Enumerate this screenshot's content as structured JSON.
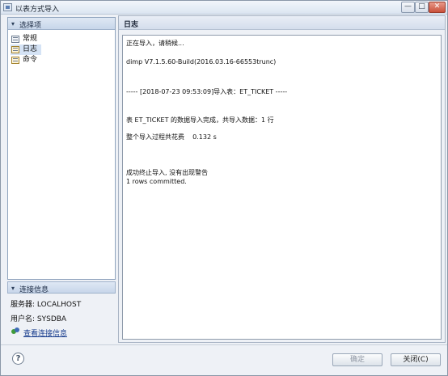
{
  "window": {
    "title": "以表方式导入",
    "min_symbol": "—",
    "max_symbol": "□",
    "close_symbol": "✕"
  },
  "sidebar": {
    "title": "选择项",
    "toggle": "▾",
    "items": [
      {
        "label": "常规",
        "icon": "document-icon"
      },
      {
        "label": "日志",
        "icon": "pencil-icon"
      },
      {
        "label": "命令",
        "icon": "pencil-icon"
      }
    ]
  },
  "connection": {
    "title": "连接信息",
    "toggle": "▾",
    "server_label": "服务器: LOCALHOST",
    "user_label": "用户名: SYSDBA",
    "link_text": "查看连接信息"
  },
  "log_panel": {
    "title": "日志",
    "lines": [
      "正在导入，请稍候...",
      "dimp V7.1.5.60-Build(2016.03.16-66553trunc)",
      "----- [2018-07-23 09:53:09]导入表：ET_TICKET -----",
      "表 ET_TICKET 的数据导入完成，共导入数据：1 行",
      "整个导入过程共花费    0.132 s",
      "成功终止导入, 没有出现警告",
      "1 rows committed."
    ]
  },
  "footer": {
    "help_symbol": "?",
    "confirm_label": "确定",
    "close_label": "关闭(C)"
  }
}
